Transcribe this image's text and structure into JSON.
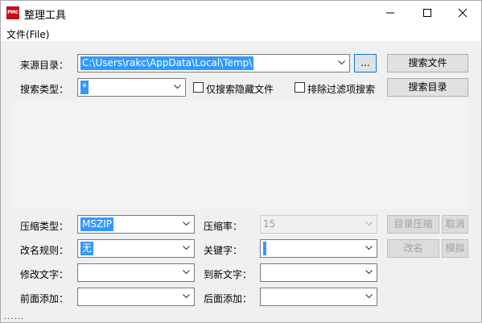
{
  "window": {
    "title": "整理工具",
    "icon_text": "PMC",
    "icon_color": "#c0121b",
    "controls": [
      "minimize-icon",
      "maximize-icon",
      "close-icon"
    ]
  },
  "menu": {
    "file": "文件(File)"
  },
  "source": {
    "label": "来源目录：",
    "value": "C:\\Users\\rakc\\AppData\\Local\\Temp\\",
    "browse_label": "...",
    "search_files_label": "搜索文件"
  },
  "search_type": {
    "label": "搜索类型：",
    "value": "*",
    "hidden_only_label": "仅搜索隐藏文件",
    "exclude_filter_label": "排除过滤项搜索",
    "search_dirs_label": "搜索目录"
  },
  "compress": {
    "type_label": "压缩类型：",
    "type_value": "MSZIP",
    "rate_label": "压缩率：",
    "rate_value": "15",
    "dir_compress_label": "目录压缩",
    "cancel_label": "取消"
  },
  "rename": {
    "rule_label": "改名规则：",
    "rule_value": "无",
    "keyword_label": "关键字：",
    "keyword_value": "",
    "rename_label": "改名",
    "simulate_label": "模拟"
  },
  "modify": {
    "modify_label": "修改文字：",
    "modify_value": "",
    "new_label": "到新文字：",
    "new_value": ""
  },
  "affix": {
    "prefix_label": "前面添加：",
    "prefix_value": "",
    "suffix_label": "后面添加：",
    "suffix_value": ""
  },
  "status_text": "......",
  "colors": {
    "selection": "#3399ff",
    "window_bg": "#f0f0f0",
    "list_bg": "#f3f3f3"
  }
}
